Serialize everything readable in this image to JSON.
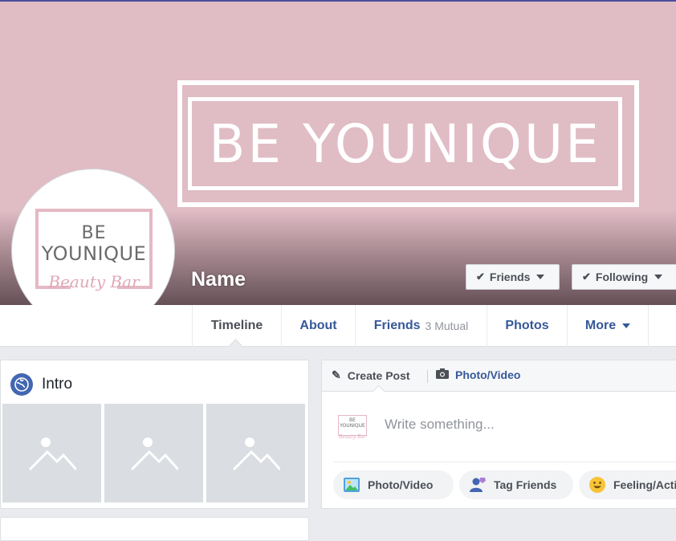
{
  "cover": {
    "logo_text": "BE YOUNIQUE",
    "bg_color": "#e0bcc5"
  },
  "profile": {
    "name": "Name",
    "avatar": {
      "line1": "BE",
      "line2": "YOUNIQUE",
      "line3": "Beauty Bar"
    }
  },
  "actions": {
    "friends_label": "Friends",
    "following_label": "Following"
  },
  "nav": {
    "tabs": [
      {
        "label": "Timeline",
        "active": true
      },
      {
        "label": "About"
      },
      {
        "label": "Friends",
        "sub": "3 Mutual"
      },
      {
        "label": "Photos"
      },
      {
        "label": "More"
      }
    ]
  },
  "intro": {
    "title": "Intro"
  },
  "composer": {
    "create_post": "Create Post",
    "photo_video_tab": "Photo/Video",
    "placeholder": "Write something...",
    "thumb_line1": "BE",
    "thumb_line2": "YOUNIQUE",
    "thumb_line3": "Beauty Bar",
    "buttons": {
      "photo_video": "Photo/Video",
      "tag_friends": "Tag Friends",
      "feeling": "Feeling/Activity"
    }
  },
  "colors": {
    "link_blue": "#365899",
    "brand_pink": "#e5b8c4"
  }
}
